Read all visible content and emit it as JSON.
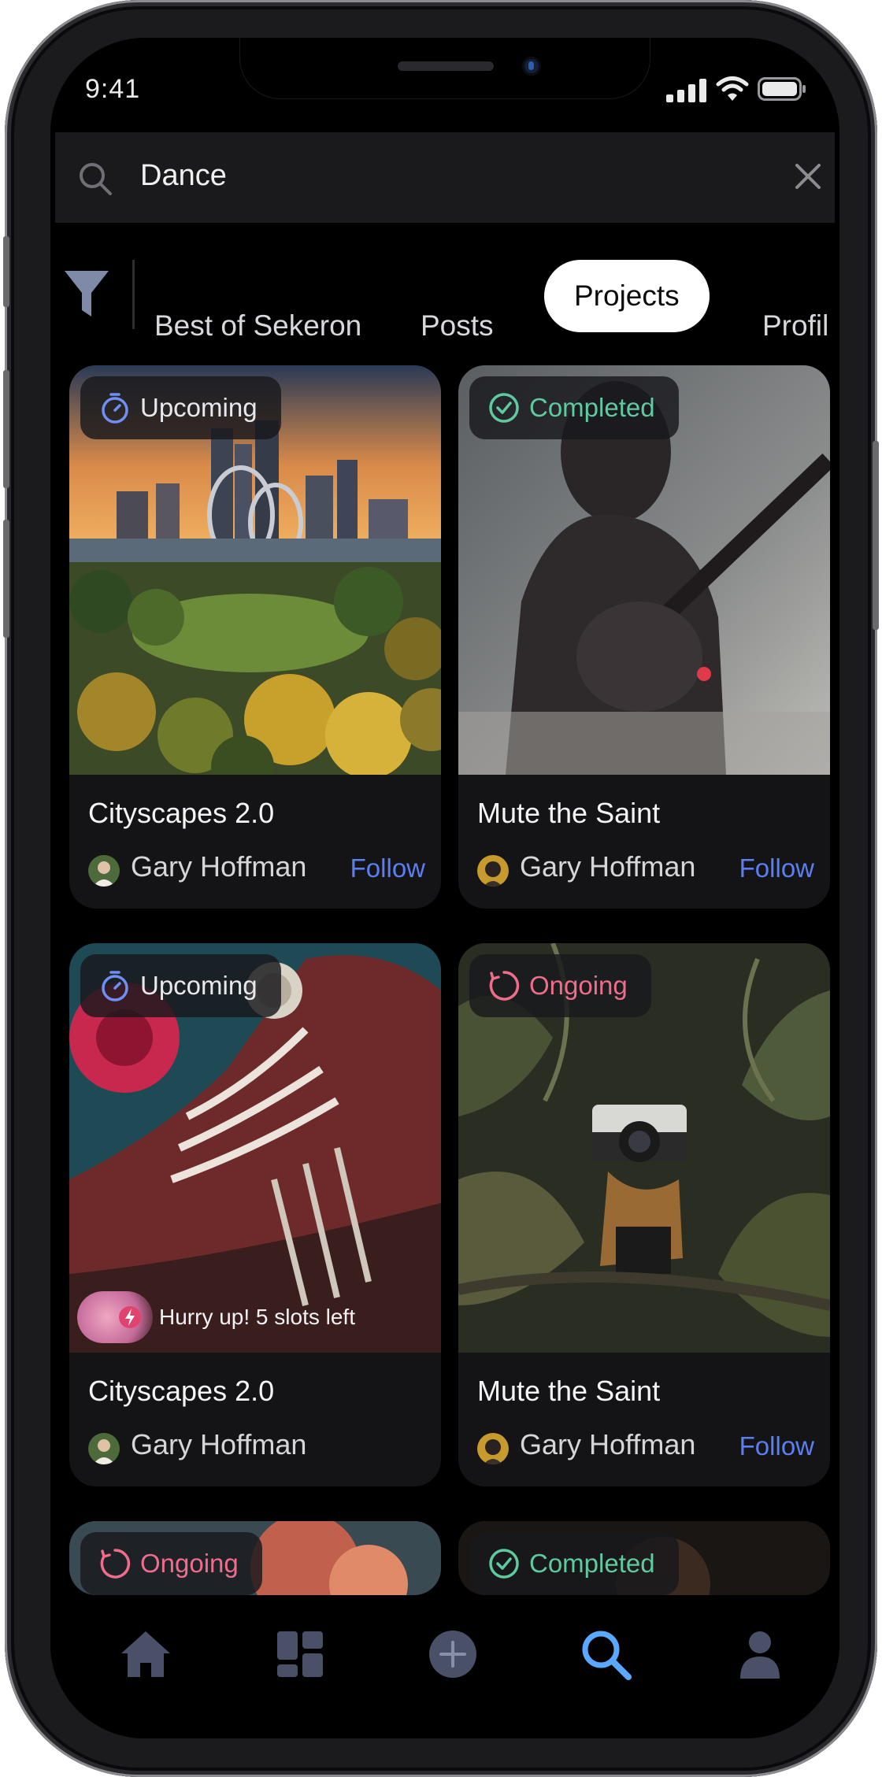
{
  "status_bar": {
    "time": "9:41"
  },
  "search": {
    "query": "Dance"
  },
  "filters": {
    "tabs": [
      {
        "label": "Best of Sekeron",
        "active": false
      },
      {
        "label": "Posts",
        "active": false
      },
      {
        "label": "Projects",
        "active": true
      },
      {
        "label": "Profil",
        "active": false
      }
    ]
  },
  "cards": [
    {
      "status": "Upcoming",
      "status_color": "#6f8ff5",
      "title": "Cityscapes 2.0",
      "author": "Gary Hoffman",
      "follow": "Follow"
    },
    {
      "status": "Completed",
      "status_color": "#5fc9a0",
      "title": "Mute the Saint",
      "author": "Gary Hoffman",
      "follow": "Follow"
    },
    {
      "status": "Upcoming",
      "status_color": "#6f8ff5",
      "title": "Cityscapes 2.0",
      "author": "Gary Hoffman",
      "notice": "Hurry up! 5 slots left"
    },
    {
      "status": "Ongoing",
      "status_color": "#ef6d8c",
      "title": "Mute the Saint",
      "author": "Gary Hoffman",
      "follow": "Follow"
    },
    {
      "status": "Ongoing",
      "status_color": "#ef6d8c"
    },
    {
      "status": "Completed",
      "status_color": "#5fc9a0"
    }
  ],
  "bottom_nav": {
    "items": [
      {
        "icon": "home-icon",
        "active": false
      },
      {
        "icon": "dashboard-icon",
        "active": false
      },
      {
        "icon": "add-icon",
        "active": false
      },
      {
        "icon": "search-icon",
        "active": true
      },
      {
        "icon": "profile-icon",
        "active": false
      }
    ],
    "active_color": "#5aa8ff",
    "inactive_color": "#4a5068"
  }
}
